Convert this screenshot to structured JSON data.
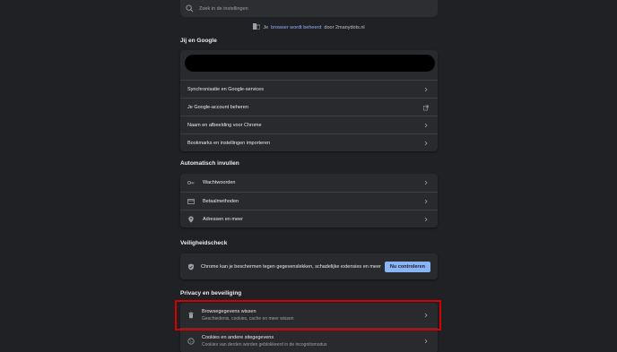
{
  "search": {
    "placeholder": "Zoek in de instellingen"
  },
  "managed": {
    "prefix": "Je",
    "link": "browser wordt beheerd",
    "suffix": "door 2manydots.nl"
  },
  "you_and_google": {
    "title": "Jij en Google",
    "items": [
      "Synchronisatie en Google-services",
      "Je Google-account beheren",
      "Naam en afbeelding voor Chrome",
      "Bookmarks en instellingen importeren"
    ]
  },
  "autofill": {
    "title": "Automatisch invullen",
    "items": [
      "Wachtwoorden",
      "Betaalmethoden",
      "Adressen en meer"
    ]
  },
  "safety_check": {
    "title": "Veiligheidscheck",
    "text": "Chrome kan je beschermen tegen gegevenslekken, schadelijke extensies en meer",
    "button": "Nu controleren"
  },
  "privacy": {
    "title": "Privacy en beveiliging",
    "items": [
      {
        "title": "Browsegegevens wissen",
        "subtitle": "Geschiedenis, cookies, cache en meer wissen"
      },
      {
        "title": "Cookies en andere sitegegevens",
        "subtitle": "Cookies van derden worden geblokkeerd in de incognitomodus"
      }
    ]
  },
  "colors": {
    "background": "#202124",
    "card": "#292a2d",
    "accent": "#8ab4f8",
    "highlight": "#d60000"
  }
}
